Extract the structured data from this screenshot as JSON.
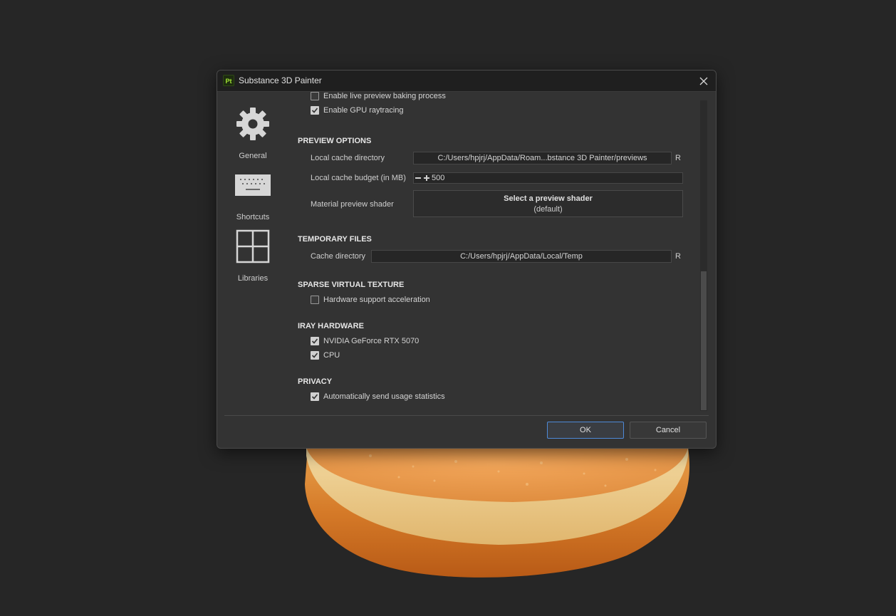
{
  "window": {
    "title": "Substance 3D Painter",
    "app_icon_text": "Pt"
  },
  "sidebar": {
    "items": [
      {
        "label": "General",
        "icon": "gear-icon"
      },
      {
        "label": "Shortcuts",
        "icon": "keyboard-icon"
      },
      {
        "label": "Libraries",
        "icon": "grid-icon"
      }
    ]
  },
  "content": {
    "partial_option": "Enable live preview baking process",
    "gpu_raytracing": {
      "label": "Enable GPU raytracing",
      "checked": true
    },
    "preview_options": {
      "title": "PREVIEW OPTIONS",
      "cache_dir_label": "Local cache directory",
      "cache_dir_value": "C:/Users/hpjrj/AppData/Roam...bstance 3D Painter/previews",
      "cache_budget_label": "Local cache budget (in MB)",
      "cache_budget_value": "500",
      "shader_label": "Material preview shader",
      "shader_button": "Select a preview shader",
      "shader_default": "(default)",
      "reset": "R"
    },
    "temporary_files": {
      "title": "TEMPORARY FILES",
      "cache_dir_label": "Cache directory",
      "cache_dir_value": "C:/Users/hpjrj/AppData/Local/Temp",
      "reset": "R"
    },
    "sparse_virtual_texture": {
      "title": "SPARSE VIRTUAL TEXTURE",
      "hw_accel": {
        "label": "Hardware support acceleration",
        "checked": false
      }
    },
    "iray_hardware": {
      "title": "IRAY HARDWARE",
      "gpu": {
        "label": "NVIDIA GeForce RTX 5070",
        "checked": true
      },
      "cpu": {
        "label": "CPU",
        "checked": true
      }
    },
    "privacy": {
      "title": "PRIVACY",
      "usage": {
        "label": "Automatically send usage statistics",
        "checked": true
      }
    }
  },
  "footer": {
    "ok": "OK",
    "cancel": "Cancel"
  },
  "colors": {
    "accent": "#4e8ad8",
    "app_icon": "#a3e635",
    "object": "#e28a3a"
  }
}
